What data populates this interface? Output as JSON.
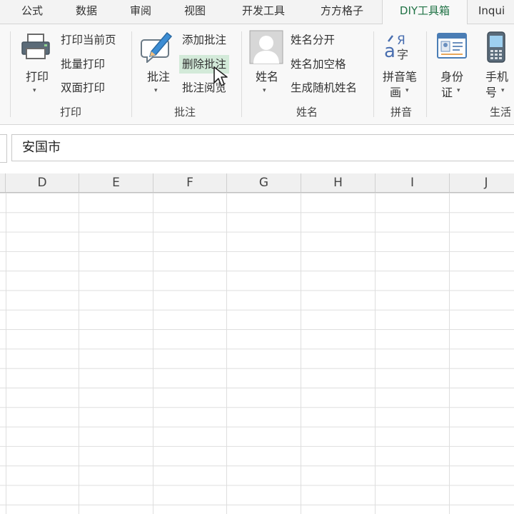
{
  "tabs": [
    {
      "label": "公式",
      "active": false
    },
    {
      "label": "数据",
      "active": false
    },
    {
      "label": "审阅",
      "active": false
    },
    {
      "label": "视图",
      "active": false
    },
    {
      "label": "开发工具",
      "active": false
    },
    {
      "label": "方方格子",
      "active": false
    },
    {
      "label": "DIY工具箱",
      "active": true
    },
    {
      "label": "Inqui",
      "active": false
    }
  ],
  "ribbon": {
    "print_group": {
      "big_button": "打印",
      "items": [
        "打印当前页",
        "批量打印",
        "双面打印"
      ],
      "label": "打印"
    },
    "comment_group": {
      "big_button": "批注",
      "items": [
        "添加批注",
        "删除批注",
        "批注阅览"
      ],
      "hovered_item": "删除批注",
      "label": "批注"
    },
    "name_group": {
      "big_button": "姓名",
      "items": [
        "姓名分开",
        "姓名加空格",
        "生成随机姓名"
      ],
      "label": "姓名"
    },
    "pinyin_group": {
      "big_button_line1": "拼音笔",
      "big_button_line2": "画",
      "label": "拼音"
    },
    "life_group": {
      "id_button_line1": "身份",
      "id_button_line2": "证",
      "phone_button_line1": "手机",
      "phone_button_line2": "号",
      "label": "生活"
    }
  },
  "formula_bar": {
    "value": "安国市"
  },
  "columns": [
    "D",
    "E",
    "F",
    "G",
    "H",
    "I",
    "J"
  ],
  "accent_color": "#217346",
  "hover_color": "#d3ead9",
  "icons": [
    "printer-icon",
    "pen-comment-icon",
    "person-icon",
    "pinyin-icon",
    "id-card-icon",
    "mobile-phone-icon",
    "mouse-cursor-icon"
  ]
}
